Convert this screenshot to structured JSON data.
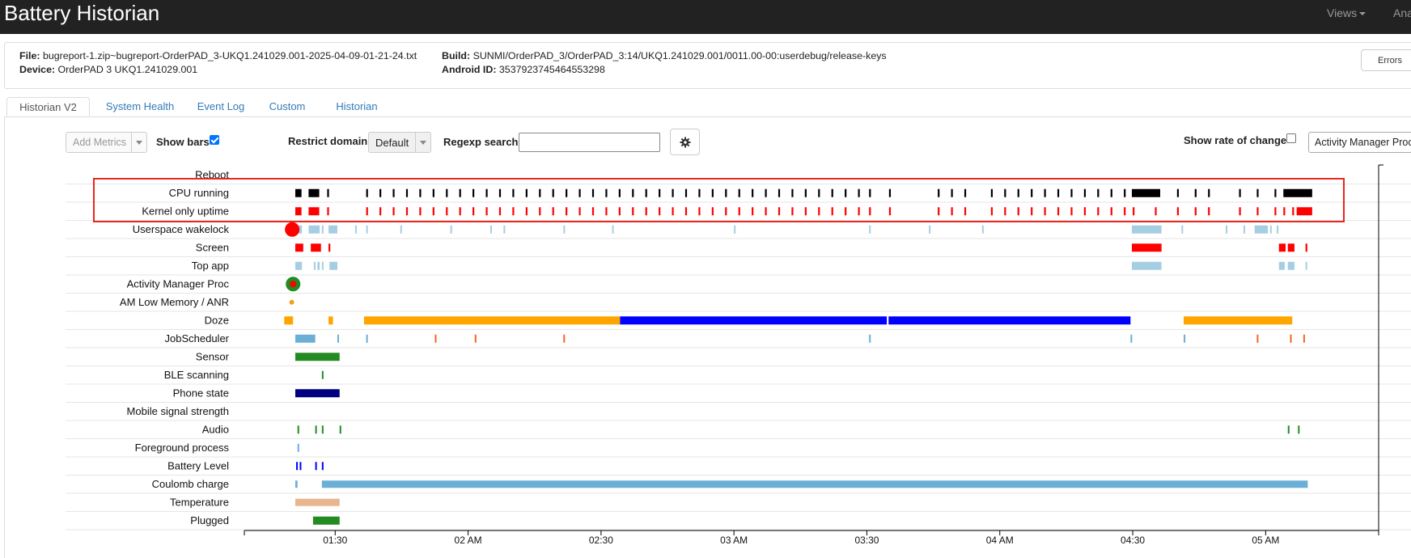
{
  "navbar": {
    "title": "Battery Historian",
    "views_label": "Views",
    "analysis_label": "Anal"
  },
  "file_info": {
    "file_label": "File:",
    "file_value": "bugreport-1.zip~bugreport-OrderPAD_3-UKQ1.241029.001-2025-04-09-01-21-24.txt",
    "device_label": "Device:",
    "device_value": "OrderPAD 3 UKQ1.241029.001",
    "build_label": "Build:",
    "build_value": "SUNMI/OrderPAD_3/OrderPAD_3:14/UKQ1.241029.001/0011.00-00:userdebug/release-keys",
    "android_id_label": "Android ID:",
    "android_id_value": "3537923745464553298",
    "errors_button": "Errors"
  },
  "tabs": [
    {
      "label": "Historian V2",
      "active": true
    },
    {
      "label": "System Health",
      "active": false
    },
    {
      "label": "Event Log",
      "active": false
    },
    {
      "label": "Custom",
      "active": false
    },
    {
      "label": "Historian",
      "active": false
    }
  ],
  "controls": {
    "add_metrics_placeholder": "Add Metrics",
    "show_bars_label": "Show bars",
    "show_bars_checked": true,
    "restrict_domain_label": "Restrict domain",
    "restrict_domain_value": "Default",
    "regexp_search_label": "Regexp search",
    "regexp_search_value": "",
    "settings_icon": "gear-icon",
    "show_rate_label": "Show rate of change",
    "show_rate_checked": false,
    "metric_select_value": "Activity Manager Proc"
  },
  "timeline": {
    "rows": [
      {
        "label": "Reboot"
      },
      {
        "label": "CPU running"
      },
      {
        "label": "Kernel only uptime"
      },
      {
        "label": "Userspace wakelock"
      },
      {
        "label": "Screen"
      },
      {
        "label": "Top app"
      },
      {
        "label": "Activity Manager Proc"
      },
      {
        "label": "AM Low Memory / ANR"
      },
      {
        "label": "Doze"
      },
      {
        "label": "JobScheduler"
      },
      {
        "label": "Sensor"
      },
      {
        "label": "BLE scanning"
      },
      {
        "label": "Phone state"
      },
      {
        "label": "Mobile signal strength"
      },
      {
        "label": "Audio"
      },
      {
        "label": "Foreground process"
      },
      {
        "label": "Battery Level"
      },
      {
        "label": "Coulomb charge"
      },
      {
        "label": "Temperature"
      },
      {
        "label": "Plugged"
      }
    ],
    "x_ticks": [
      {
        "label": "01:30",
        "t": 90
      },
      {
        "label": "02 AM",
        "t": 120
      },
      {
        "label": "02:30",
        "t": 150
      },
      {
        "label": "03 AM",
        "t": 180
      },
      {
        "label": "03:30",
        "t": 210
      },
      {
        "label": "04 AM",
        "t": 240
      },
      {
        "label": "04:30",
        "t": 270
      },
      {
        "label": "05 AM",
        "t": 300
      }
    ],
    "time_range_minutes": [
      69.5,
      325.5
    ],
    "highlight_rows": [
      "CPU running",
      "Kernel only uptime"
    ],
    "highlight_color": "#e8281e",
    "colors": {
      "cpu": "#000000",
      "kernel": "#ff0000",
      "wakelock": "#a6cee3",
      "screen": "#ff0000",
      "top_app": "#a6cee3",
      "am_proc": "#228b22",
      "doze_light": "#ffa500",
      "doze_deep": "#0000ff",
      "jobscheduler": "#6baed6",
      "jobscheduler_alt": "#f26522",
      "sensor": "#228b22",
      "phone_state": "#000080",
      "audio": "#228b22",
      "battery": "#0000ff",
      "coulomb": "#6baed6",
      "temperature": "#e8b58f",
      "plugged": "#228b22"
    },
    "series": {
      "Reboot": [],
      "CPU running": [
        [
          81,
          82.4
        ],
        [
          84,
          86.4
        ],
        [
          88.2,
          88.6
        ],
        [
          97,
          97.4
        ],
        [
          100,
          100.4
        ],
        [
          103,
          103.4
        ],
        [
          106,
          106.4
        ],
        [
          109,
          109.4
        ],
        [
          112,
          112.4
        ],
        [
          115,
          115.4
        ],
        [
          118,
          118.4
        ],
        [
          121,
          121.4
        ],
        [
          124,
          124.4
        ],
        [
          127,
          127.4
        ],
        [
          130,
          130.4
        ],
        [
          133,
          133.4
        ],
        [
          136,
          136.4
        ],
        [
          139,
          139.4
        ],
        [
          142,
          142.4
        ],
        [
          145,
          145.4
        ],
        [
          148,
          148.4
        ],
        [
          151,
          151.4
        ],
        [
          154,
          154.4
        ],
        [
          157,
          157.4
        ],
        [
          160,
          160.4
        ],
        [
          163,
          163.4
        ],
        [
          166,
          166.4
        ],
        [
          169,
          169.4
        ],
        [
          172,
          172.4
        ],
        [
          175,
          175.4
        ],
        [
          178,
          178.4
        ],
        [
          181,
          181.4
        ],
        [
          184,
          184.4
        ],
        [
          187,
          187.4
        ],
        [
          190,
          190.4
        ],
        [
          193,
          193.4
        ],
        [
          196,
          196.4
        ],
        [
          199,
          199.4
        ],
        [
          202,
          202.4
        ],
        [
          205,
          205.4
        ],
        [
          208,
          208.4
        ],
        [
          210.5,
          210.9
        ],
        [
          215,
          215.4
        ],
        [
          226,
          226.4
        ],
        [
          229,
          229.4
        ],
        [
          232,
          232.4
        ],
        [
          238,
          238.4
        ],
        [
          241,
          241.4
        ],
        [
          244,
          244.4
        ],
        [
          247,
          247.4
        ],
        [
          250,
          250.4
        ],
        [
          253,
          253.4
        ],
        [
          256,
          256.4
        ],
        [
          259,
          259.4
        ],
        [
          262,
          262.4
        ],
        [
          265,
          265.4
        ],
        [
          268,
          268.4
        ],
        [
          269.8,
          276.2
        ],
        [
          280,
          280.4
        ],
        [
          284,
          284.4
        ],
        [
          287,
          287.4
        ],
        [
          294,
          294.4
        ],
        [
          298,
          298.4
        ],
        [
          302,
          302.4
        ],
        [
          304,
          310.5
        ]
      ],
      "Kernel only uptime": [
        [
          81,
          82.4
        ],
        [
          84,
          86.4
        ],
        [
          88.2,
          88.6
        ],
        [
          97,
          97.4
        ],
        [
          100,
          100.4
        ],
        [
          103,
          103.4
        ],
        [
          106,
          106.4
        ],
        [
          109,
          109.4
        ],
        [
          112,
          112.4
        ],
        [
          115,
          115.4
        ],
        [
          118,
          118.4
        ],
        [
          121,
          121.4
        ],
        [
          124,
          124.4
        ],
        [
          127,
          127.4
        ],
        [
          130,
          130.4
        ],
        [
          133,
          133.4
        ],
        [
          136,
          136.4
        ],
        [
          139,
          139.4
        ],
        [
          142,
          142.4
        ],
        [
          145,
          145.4
        ],
        [
          148,
          148.4
        ],
        [
          151,
          151.4
        ],
        [
          154,
          154.4
        ],
        [
          157,
          157.4
        ],
        [
          160,
          160.4
        ],
        [
          163,
          163.4
        ],
        [
          166,
          166.4
        ],
        [
          169,
          169.4
        ],
        [
          172,
          172.4
        ],
        [
          175,
          175.4
        ],
        [
          178,
          178.4
        ],
        [
          181,
          181.4
        ],
        [
          184,
          184.4
        ],
        [
          187,
          187.4
        ],
        [
          190,
          190.4
        ],
        [
          193,
          193.4
        ],
        [
          196,
          196.4
        ],
        [
          199,
          199.4
        ],
        [
          202,
          202.4
        ],
        [
          205,
          205.4
        ],
        [
          208,
          208.4
        ],
        [
          210.5,
          210.9
        ],
        [
          215,
          215.4
        ],
        [
          226,
          226.4
        ],
        [
          229,
          229.4
        ],
        [
          232,
          232.4
        ],
        [
          238,
          238.4
        ],
        [
          241,
          241.4
        ],
        [
          244,
          244.4
        ],
        [
          247,
          247.4
        ],
        [
          250,
          250.4
        ],
        [
          253,
          253.4
        ],
        [
          256,
          256.4
        ],
        [
          259,
          259.4
        ],
        [
          262,
          262.4
        ],
        [
          265,
          265.4
        ],
        [
          268,
          268.4
        ],
        [
          270,
          270.4
        ],
        [
          275,
          275.4
        ],
        [
          280,
          280.4
        ],
        [
          284,
          284.4
        ],
        [
          287,
          287.4
        ],
        [
          294,
          294.4
        ],
        [
          298,
          298.4
        ],
        [
          302,
          302.4
        ],
        [
          304,
          304.4
        ],
        [
          306,
          306.4
        ],
        [
          307,
          310.5
        ]
      ],
      "Userspace wakelock": [
        [
          81,
          82.5
        ],
        [
          84,
          86.5
        ],
        [
          87,
          87.3
        ],
        [
          88.5,
          90.5
        ],
        [
          94.5,
          94.8
        ],
        [
          97,
          97.3
        ],
        [
          104.7,
          105
        ],
        [
          116,
          116.3
        ],
        [
          125,
          125.3
        ],
        [
          128,
          128.3
        ],
        [
          141.5,
          141.8
        ],
        [
          152.5,
          152.8
        ],
        [
          180,
          180.3
        ],
        [
          210.5,
          210.8
        ],
        [
          224,
          224.3
        ],
        [
          236,
          236.3
        ],
        [
          269.8,
          276.5
        ],
        [
          281,
          281.3
        ],
        [
          291,
          291.3
        ],
        [
          295,
          295.3
        ],
        [
          297.5,
          300.5
        ],
        [
          301,
          301.3
        ],
        [
          302.5,
          302.8
        ]
      ],
      "Screen": [
        [
          81,
          82.8
        ],
        [
          84.5,
          86.8
        ],
        [
          88.5,
          88.9
        ],
        [
          269.8,
          276.5
        ],
        [
          303,
          304.5
        ],
        [
          305,
          306.5
        ],
        [
          309,
          309.4
        ]
      ],
      "Top app": [
        [
          81,
          82.5
        ],
        [
          85.2,
          85.5
        ],
        [
          86,
          86.5
        ],
        [
          87,
          87.3
        ],
        [
          88.7,
          90.5
        ],
        [
          269.8,
          276.5
        ],
        [
          303,
          304.3
        ],
        [
          305,
          306.5
        ],
        [
          309,
          309.3
        ]
      ],
      "Activity Manager Proc": [],
      "AM Low Memory / ANR": [],
      "Doze": [
        [
          78.5,
          80.3
        ],
        [
          79.5,
          80.5
        ],
        [
          88.5,
          89.5
        ],
        [
          96.5,
          154.3
        ],
        [
          154.3,
          214.5
        ],
        [
          214.9,
          269.5
        ],
        [
          281.5,
          306
        ]
      ],
      "JobScheduler": [
        [
          81,
          85.5
        ],
        [
          90.5,
          90.8
        ],
        [
          97,
          97.3
        ],
        [
          112.5,
          112.8
        ],
        [
          121.5,
          121.8
        ],
        [
          141.5,
          141.8
        ],
        [
          210.5,
          210.8
        ],
        [
          269.5,
          269.8
        ],
        [
          281.5,
          281.8
        ],
        [
          298,
          298.3
        ],
        [
          305.5,
          305.8
        ],
        [
          308.5,
          308.8
        ]
      ],
      "Sensor": [
        [
          81,
          91
        ]
      ],
      "BLE scanning": [
        [
          87,
          87.3
        ]
      ],
      "Phone state": [
        [
          81,
          91
        ]
      ],
      "Mobile signal strength": [],
      "Audio": [
        [
          81.5,
          81.8
        ],
        [
          85.5,
          85.8
        ],
        [
          87,
          87.3
        ],
        [
          91,
          91.3
        ],
        [
          305,
          305.3
        ],
        [
          307.3,
          307.6
        ]
      ],
      "Foreground process": [
        [
          81.5,
          81.8
        ]
      ],
      "Battery Level": [
        [
          81.2,
          81.5
        ],
        [
          82,
          82.3
        ],
        [
          85.5,
          85.8
        ],
        [
          87,
          87.3
        ]
      ],
      "Coulomb charge": [
        [
          81,
          81.5
        ],
        [
          87,
          309.5
        ]
      ],
      "Temperature": [
        [
          81,
          91
        ]
      ],
      "Plugged": [
        [
          85,
          91
        ]
      ]
    }
  }
}
